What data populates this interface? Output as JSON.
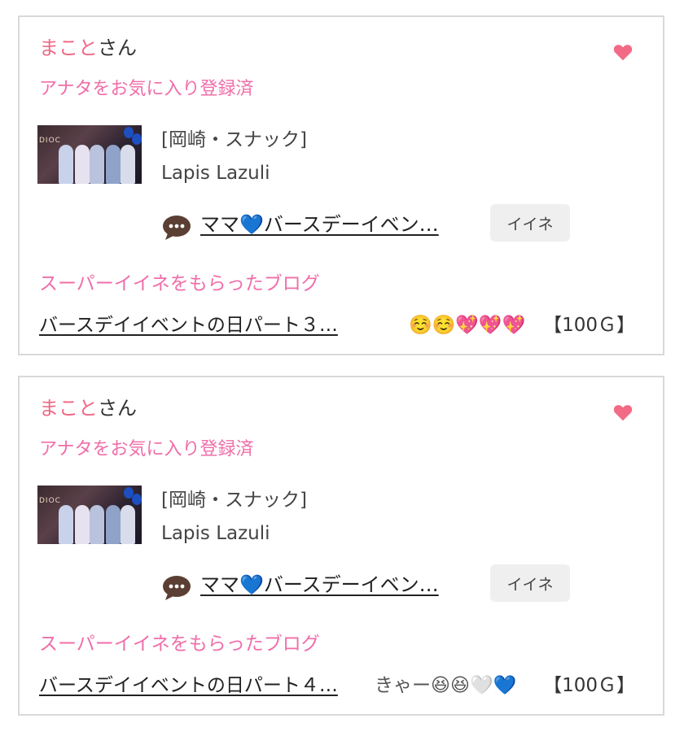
{
  "cards": [
    {
      "user_name": "まこと",
      "user_suffix": "さん",
      "favorite_status": "アナタをお気に入り登録済",
      "shop_category": "[岡崎・スナック]",
      "shop_name": "Lapis Lazuli",
      "blog_title": "ママ💙バースデーイベン…",
      "iine_label": "イイネ",
      "super_heading": "スーパーイイネをもらったブログ",
      "super_blog_title": "バースデイイベントの日パート３…",
      "comment": "☺️☺️💖💖💖",
      "reward": "【100Ｇ】"
    },
    {
      "user_name": "まこと",
      "user_suffix": "さん",
      "favorite_status": "アナタをお気に入り登録済",
      "shop_category": "[岡崎・スナック]",
      "shop_name": "Lapis Lazuli",
      "blog_title": "ママ💙バースデーイベン…",
      "iine_label": "イイネ",
      "super_heading": "スーパーイイネをもらったブログ",
      "super_blog_title": "バースデイイベントの日パート４…",
      "comment": "きゃー😆😆🤍💙",
      "reward": "【100Ｇ】"
    }
  ],
  "colors": {
    "accent_pink": "#f06ea9",
    "name_pink": "#ee6a86",
    "heart": "#f26a86",
    "border": "#d9d9d9",
    "button_bg": "#efefef"
  },
  "icons": {
    "favorite": "heart-icon",
    "comment": "speech-bubble-icon"
  }
}
